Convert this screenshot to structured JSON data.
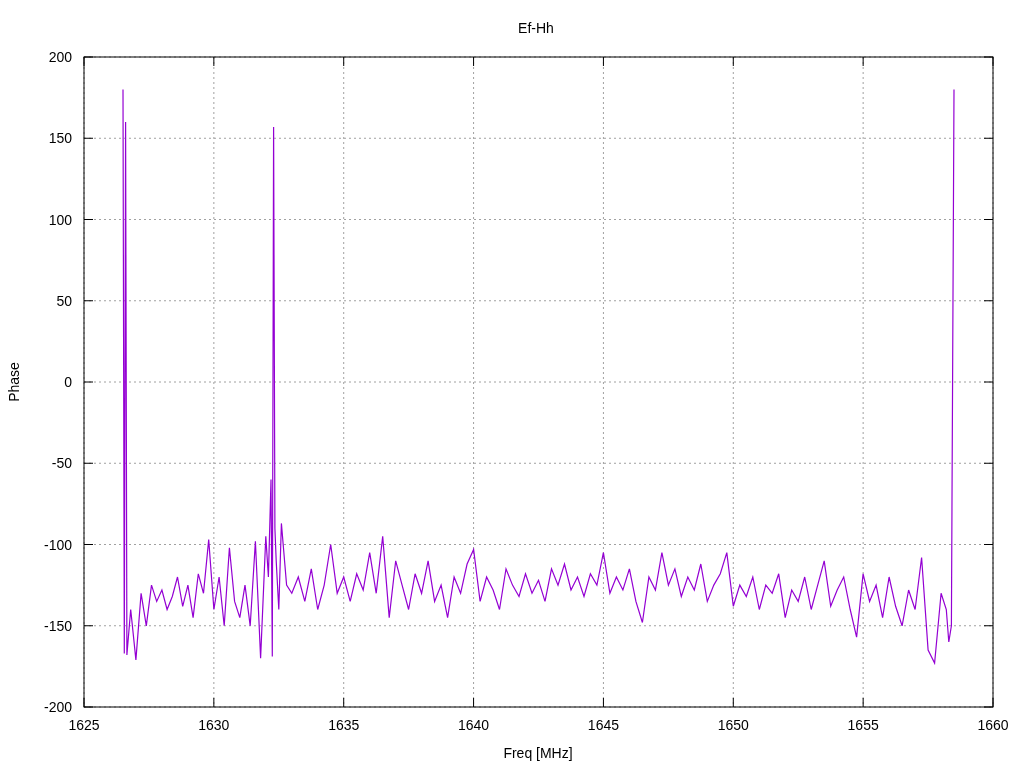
{
  "chart_data": {
    "type": "line",
    "title": "Ef-Hh",
    "xlabel": "Freq [MHz]",
    "ylabel": "Phase",
    "xlim": [
      1625,
      1660
    ],
    "ylim": [
      -200,
      200
    ],
    "xticks": [
      1625,
      1630,
      1635,
      1640,
      1645,
      1650,
      1655,
      1660
    ],
    "yticks": [
      -200,
      -150,
      -100,
      -50,
      0,
      50,
      100,
      150,
      200
    ],
    "x": [
      1626.5,
      1626.55,
      1626.6,
      1626.65,
      1626.8,
      1627.0,
      1627.2,
      1627.4,
      1627.6,
      1627.8,
      1628.0,
      1628.2,
      1628.4,
      1628.6,
      1628.8,
      1629.0,
      1629.2,
      1629.4,
      1629.6,
      1629.8,
      1630.0,
      1630.2,
      1630.4,
      1630.6,
      1630.8,
      1631.0,
      1631.2,
      1631.4,
      1631.6,
      1631.8,
      1632.0,
      1632.1,
      1632.2,
      1632.25,
      1632.3,
      1632.35,
      1632.4,
      1632.5,
      1632.6,
      1632.8,
      1633.0,
      1633.25,
      1633.5,
      1633.75,
      1634,
      1634.25,
      1634.5,
      1634.75,
      1635,
      1635.25,
      1635.5,
      1635.75,
      1636,
      1636.25,
      1636.5,
      1636.75,
      1637,
      1637.25,
      1637.5,
      1637.75,
      1638,
      1638.25,
      1638.5,
      1638.75,
      1639,
      1639.25,
      1639.5,
      1639.75,
      1640,
      1640.25,
      1640.5,
      1640.75,
      1641,
      1641.25,
      1641.5,
      1641.75,
      1642,
      1642.25,
      1642.5,
      1642.75,
      1643,
      1643.25,
      1643.5,
      1643.75,
      1644,
      1644.25,
      1644.5,
      1644.75,
      1645,
      1645.25,
      1645.5,
      1645.75,
      1646,
      1646.25,
      1646.5,
      1646.75,
      1647,
      1647.25,
      1647.5,
      1647.75,
      1648,
      1648.25,
      1648.5,
      1648.75,
      1649,
      1649.25,
      1649.5,
      1649.75,
      1650,
      1650.25,
      1650.5,
      1650.75,
      1651,
      1651.25,
      1651.5,
      1651.75,
      1652,
      1652.25,
      1652.5,
      1652.75,
      1653,
      1653.25,
      1653.5,
      1653.75,
      1654,
      1654.25,
      1654.5,
      1654.75,
      1655,
      1655.25,
      1655.5,
      1655.75,
      1656,
      1656.25,
      1656.5,
      1656.75,
      1657,
      1657.25,
      1657.5,
      1657.75,
      1658,
      1658.2,
      1658.3,
      1658.4,
      1658.45,
      1658.5
    ],
    "grid": true,
    "series": [
      {
        "color": "#9400d3",
        "values": [
          180,
          -167,
          160,
          -168,
          -140,
          -171,
          -130,
          -150,
          -125,
          -135,
          -128,
          -140,
          -132,
          -120,
          -138,
          -125,
          -145,
          -118,
          -130,
          -97,
          -140,
          -120,
          -150,
          -102,
          -135,
          -145,
          -125,
          -150,
          -98,
          -170,
          -95,
          -120,
          -60,
          -169,
          157,
          -90,
          -110,
          -140,
          -87,
          -125,
          -130,
          -120,
          -135,
          -115,
          -140,
          -125,
          -100,
          -130,
          -120,
          -135,
          -118,
          -128,
          -105,
          -130,
          -95,
          -145,
          -110,
          -125,
          -140,
          -118,
          -130,
          -110,
          -135,
          -125,
          -145,
          -120,
          -130,
          -112,
          -103,
          -135,
          -120,
          -128,
          -140,
          -115,
          -125,
          -132,
          -118,
          -130,
          -122,
          -135,
          -115,
          -125,
          -112,
          -128,
          -120,
          -132,
          -118,
          -125,
          -105,
          -130,
          -120,
          -128,
          -115,
          -135,
          -148,
          -120,
          -128,
          -105,
          -125,
          -115,
          -132,
          -120,
          -128,
          -112,
          -135,
          -125,
          -118,
          -105,
          -138,
          -125,
          -132,
          -120,
          -140,
          -125,
          -130,
          -118,
          -145,
          -128,
          -135,
          -120,
          -140,
          -125,
          -110,
          -138,
          -128,
          -120,
          -140,
          -157,
          -118,
          -135,
          -125,
          -145,
          -120,
          -138,
          -150,
          -128,
          -140,
          -108,
          -165,
          -173,
          -130,
          -140,
          -160,
          -150,
          15,
          180
        ]
      }
    ]
  }
}
